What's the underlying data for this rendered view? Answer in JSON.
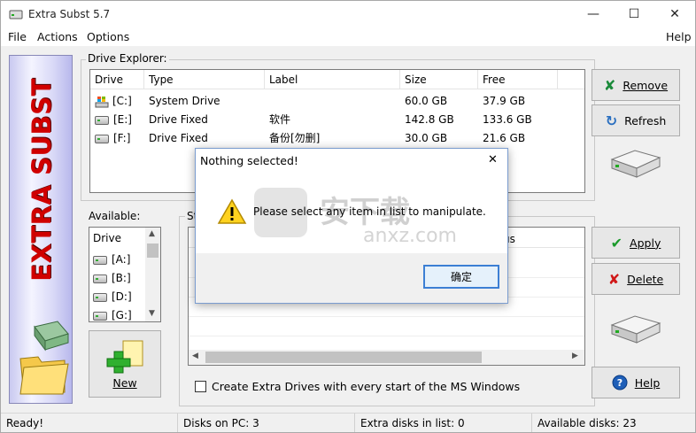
{
  "window": {
    "title": "Extra Subst 5.7",
    "minimize_glyph": "—",
    "maximize_glyph": "☐",
    "close_glyph": "✕"
  },
  "menu": {
    "file": "File",
    "actions": "Actions",
    "options": "Options",
    "help": "Help"
  },
  "sidebar": {
    "brand": "EXTRA SUBST"
  },
  "drive_explorer": {
    "label": "Drive Explorer:",
    "columns": [
      "Drive",
      "Type",
      "Label",
      "Size",
      "Free"
    ],
    "rows": [
      {
        "drive": "[C:]",
        "type": "System Drive",
        "label": "",
        "size": "60.0 GB",
        "free": "37.9 GB"
      },
      {
        "drive": "[E:]",
        "type": "Drive Fixed",
        "label": "软件",
        "size": "142.8 GB",
        "free": "133.6 GB"
      },
      {
        "drive": "[F:]",
        "type": "Drive Fixed",
        "label": "备份[勿删]",
        "size": "30.0 GB",
        "free": "21.6 GB"
      }
    ]
  },
  "available": {
    "label": "Available:",
    "column": "Drive",
    "items": [
      "[A:]",
      "[B:]",
      "[D:]",
      "[G:]"
    ]
  },
  "substituted": {
    "label": "St",
    "status_fragment": "us"
  },
  "buttons": {
    "remove": "Remove",
    "refresh": "Refresh",
    "apply": "Apply",
    "delete": "Delete",
    "help": "Help",
    "new": "New"
  },
  "startup_checkbox": {
    "label": "Create Extra Drives with every start of the MS Windows",
    "checked": false
  },
  "status": {
    "ready": "Ready!",
    "disks_on_pc": "Disks on PC: 3",
    "extra_disks": "Extra disks in list: 0",
    "available_disks": "Available disks: 23"
  },
  "dialog": {
    "title": "Nothing selected!",
    "message": "Please select any item in list to manipulate.",
    "ok": "确定",
    "close_glyph": "✕"
  },
  "watermark": {
    "text": "安下载",
    "sub": "anxz.com"
  },
  "colors": {
    "brand_red": "#d00000",
    "accent_blue": "#3c7fd4",
    "remove_green": "#1a8a3a",
    "delete_red": "#d01818"
  }
}
